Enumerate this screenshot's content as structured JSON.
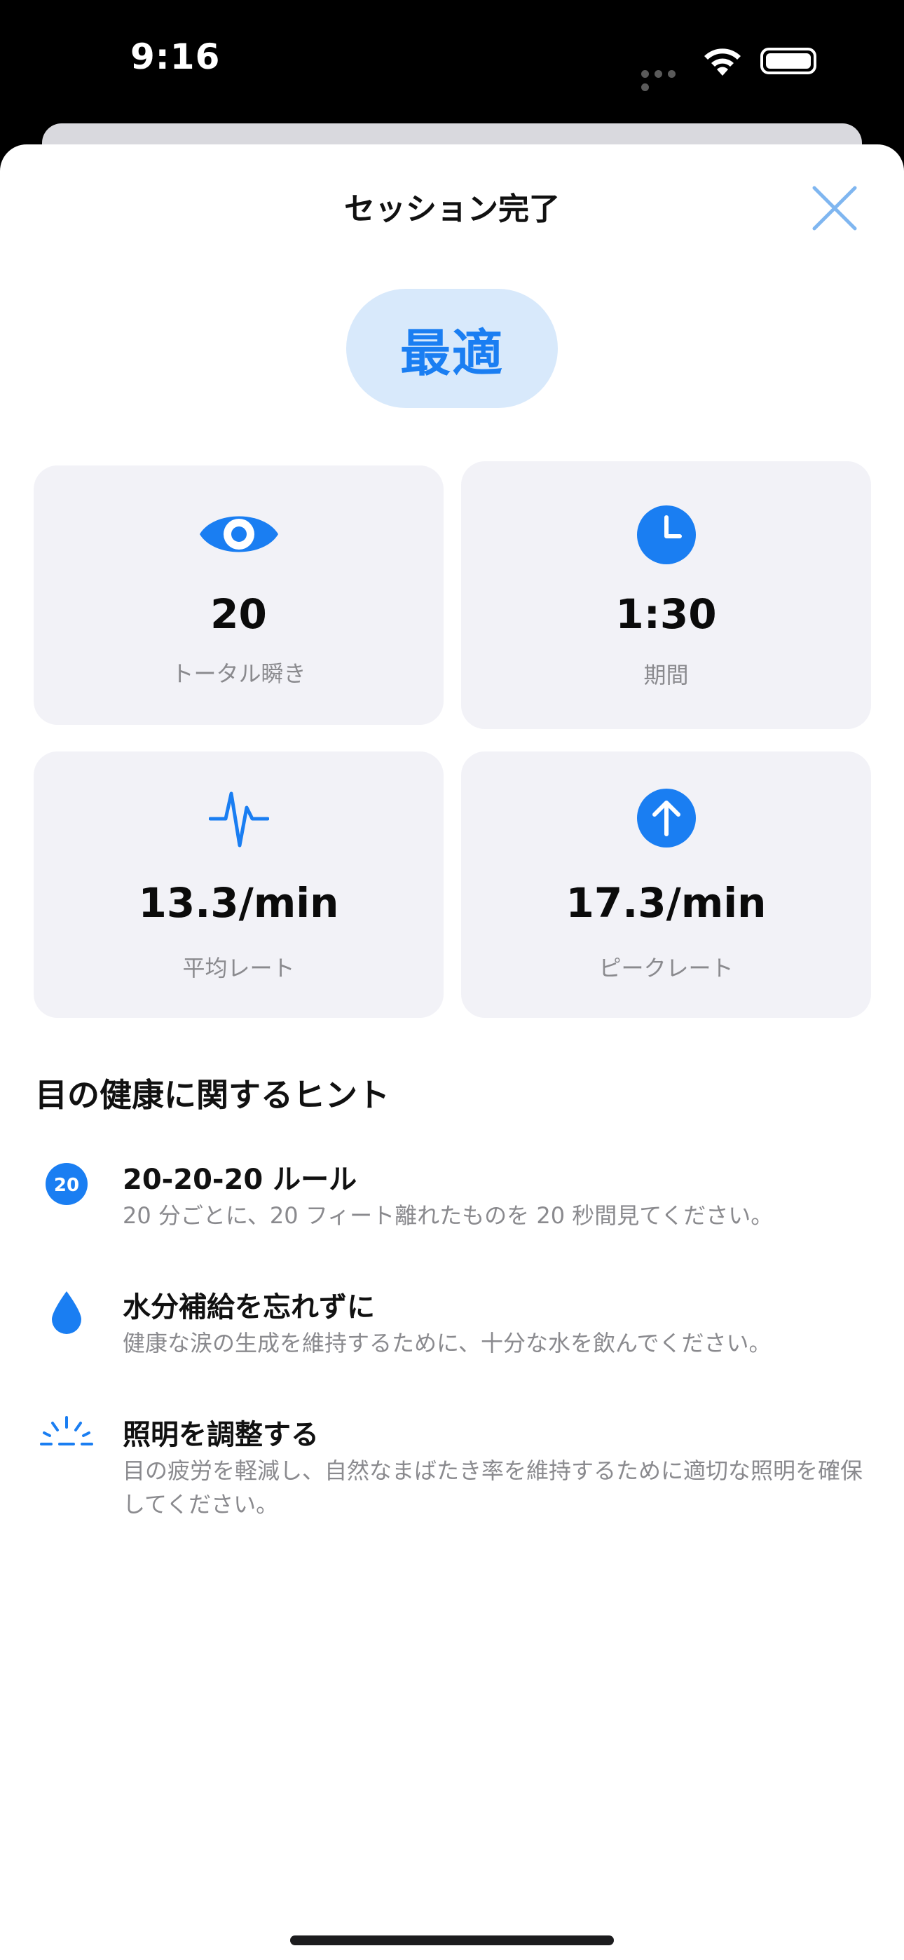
{
  "status_bar": {
    "time": "9:16"
  },
  "sheet": {
    "title": "セッション完了",
    "badge": "最適"
  },
  "stats": [
    {
      "icon": "eye-icon",
      "value": "20",
      "label": "トータル瞬き"
    },
    {
      "icon": "clock-icon",
      "value": "1:30",
      "label": "期間"
    },
    {
      "icon": "waveform-icon",
      "value": "13.3/min",
      "label": "平均レート"
    },
    {
      "icon": "arrow-up-circle-icon",
      "value": "17.3/min",
      "label": "ピークレート"
    }
  ],
  "tips_section": {
    "title": "目の健康に関するヒント",
    "badge_number": "20",
    "items": [
      {
        "icon": "20-badge-icon",
        "title": "20-20-20 ルール",
        "description": "20 分ごとに、20 フィート離れたものを 20 秒間見てください。"
      },
      {
        "icon": "drop-icon",
        "title": "水分補給を忘れずに",
        "description": "健康な涙の生成を維持するために、十分な水を飲んでください。"
      },
      {
        "icon": "light-icon",
        "title": "照明を調整する",
        "description": "目の疲労を軽減し、自然なまばたき率を維持するために適切な照明を確保してください。"
      }
    ]
  },
  "colors": {
    "accent": "#1a7ef2",
    "badge_bg": "#d8e9fb",
    "card_bg": "#f2f2f7",
    "secondary_text": "#8a8a8e"
  }
}
